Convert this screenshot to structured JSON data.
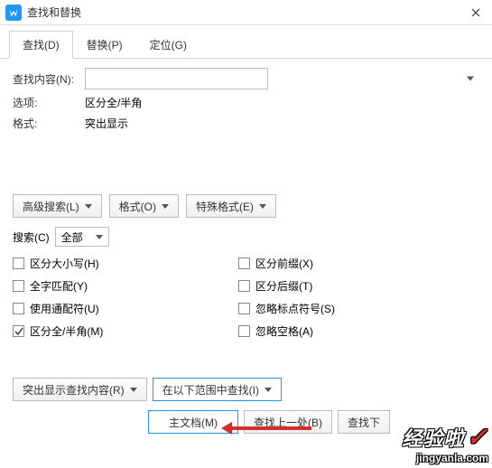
{
  "window": {
    "title": "查找和替换"
  },
  "tabs": {
    "find": "查找(D)",
    "replace": "替换(P)",
    "goto": "定位(G)"
  },
  "labels": {
    "find_content": "查找内容(N):",
    "options": "选项:",
    "format": "格式:",
    "options_val": "区分全/半角",
    "format_val": "突出显示",
    "search": "搜索(C)"
  },
  "search_scope": "全部",
  "buttons": {
    "adv": "高级搜索(L)",
    "fmt": "格式(O)",
    "special": "特殊格式(E)",
    "highlight": "突出显示查找内容(R)",
    "in_range": "在以下范围中查找(I)",
    "main_doc": "主文档(M)",
    "find_prev": "查找上一处(B)",
    "find_next": "查找下"
  },
  "checks": {
    "case": "区分大小写(H)",
    "whole": "全字匹配(Y)",
    "wildcard": "使用通配符(U)",
    "fullhalf": "区分全/半角(M)",
    "prefix": "区分前缀(X)",
    "suffix": "区分后缀(T)",
    "punct": "忽略标点符号(S)",
    "space": "忽略空格(A)"
  },
  "watermark": {
    "main": "经验啦",
    "sub": "jingyanla.com"
  }
}
